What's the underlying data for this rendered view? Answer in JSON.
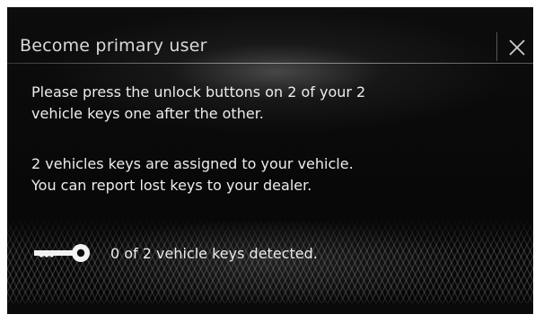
{
  "dialog": {
    "title": "Become primary user",
    "close_icon": "close-icon",
    "paragraph_1": [
      "Please press the unlock buttons on 2 of your 2",
      "vehicle keys one after the other."
    ],
    "paragraph_2": [
      "2 vehicles keys are assigned to your vehicle.",
      "You can report lost keys to your dealer."
    ],
    "key_status": {
      "icon": "car-key-icon",
      "text": "0 of 2 vehicle keys detected."
    }
  },
  "colors": {
    "background": "#070707",
    "text": "#ececec",
    "title_text": "#d9d9d9"
  }
}
